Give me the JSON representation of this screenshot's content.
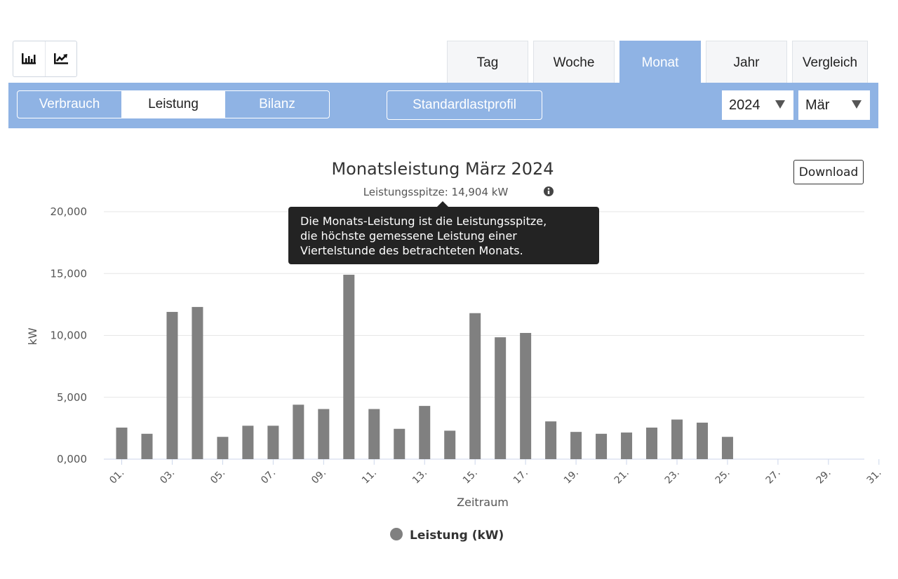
{
  "period_tabs": [
    {
      "label": "Tag",
      "active": false
    },
    {
      "label": "Woche",
      "active": false
    },
    {
      "label": "Monat",
      "active": true
    },
    {
      "label": "Jahr",
      "active": false
    },
    {
      "label": "Vergleich",
      "active": false
    }
  ],
  "chart_type_toggle": {
    "icons": [
      "bar-chart-icon",
      "line-chart-icon"
    ]
  },
  "filter_bar": {
    "segments": [
      {
        "label": "Verbrauch",
        "active": false
      },
      {
        "label": "Leistung",
        "active": true
      },
      {
        "label": "Bilanz",
        "active": false
      }
    ],
    "profile_button": "Standardlastprofil",
    "year_select": "2024",
    "month_select": "Mär"
  },
  "download_label": "Download",
  "tooltip": {
    "lines": [
      "Die Monats-Leistung ist die Leistungsspitze,",
      "die höchste gemessene Leistung einer",
      "Viertelstunde des betrachteten Monats."
    ]
  },
  "colors": {
    "accent": "#8fb3e4",
    "bar": "#808080",
    "tooltip_bg": "#232323"
  },
  "chart_data": {
    "type": "bar",
    "title": "Monatsleistung März 2024",
    "subtitle": "Leistungsspitze: 14,904 kW",
    "subtitle_icon": "info-circle-icon",
    "xlabel": "Zeitraum",
    "ylabel": "kW",
    "ylim": [
      0,
      20000
    ],
    "yticks": [
      "0,000",
      "5,000",
      "10,000",
      "15,000",
      "20,000"
    ],
    "ytick_values": [
      0,
      5000,
      10000,
      15000,
      20000
    ],
    "categories": [
      "01.",
      "02.",
      "03.",
      "04.",
      "05.",
      "06.",
      "07.",
      "08.",
      "09.",
      "10.",
      "11.",
      "12.",
      "13.",
      "14.",
      "15.",
      "16.",
      "17.",
      "18.",
      "19.",
      "20.",
      "21.",
      "22.",
      "23.",
      "24.",
      "25.",
      "26.",
      "27.",
      "28.",
      "29.",
      "30.",
      "31."
    ],
    "xtick_labels": [
      "01.",
      "03.",
      "05.",
      "07.",
      "09.",
      "11.",
      "13.",
      "15.",
      "17.",
      "19.",
      "21.",
      "23.",
      "25.",
      "27.",
      "29.",
      "31."
    ],
    "series": [
      {
        "name": "Leistung (kW)",
        "color": "#808080",
        "values": [
          2550,
          2050,
          11900,
          12300,
          1800,
          2700,
          2700,
          4400,
          4050,
          14904,
          4050,
          2450,
          4300,
          2300,
          11800,
          9850,
          10200,
          3050,
          2200,
          2050,
          2150,
          2550,
          3200,
          2950,
          1800,
          null,
          null,
          null,
          null,
          null,
          null
        ]
      }
    ],
    "grid": true,
    "legend_position": "bottom-center"
  }
}
